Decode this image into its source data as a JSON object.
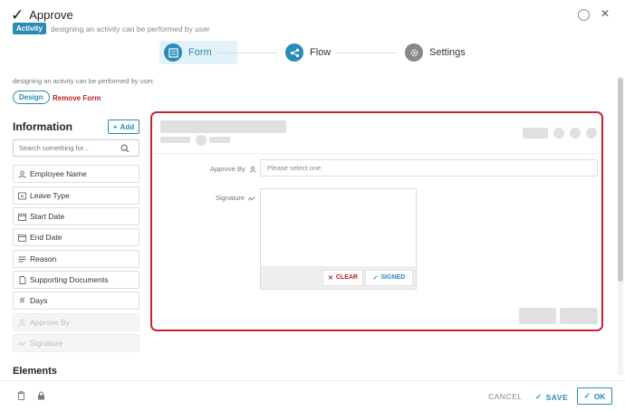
{
  "header": {
    "title": "Approve",
    "badge": "Activity",
    "subtitle": "designing an activity can be performed by user"
  },
  "stepper": {
    "steps": [
      {
        "label": "Form",
        "icon": "form-icon",
        "active": true
      },
      {
        "label": "Flow",
        "icon": "flow-icon",
        "active": false
      },
      {
        "label": "Settings",
        "icon": "gear-icon",
        "active": false
      }
    ]
  },
  "description": "designing an activity can be performed by user.",
  "toolbar": {
    "design_label": "Design",
    "remove_label": "Remove Form"
  },
  "sidebar": {
    "title": "Information",
    "add_label": "Add",
    "search_placeholder": "Search something for...",
    "fields": [
      {
        "label": "Employee Name",
        "icon": "user-icon",
        "disabled": false
      },
      {
        "label": "Leave Type",
        "icon": "dropdown-icon",
        "disabled": false
      },
      {
        "label": "Start Date",
        "icon": "calendar-icon",
        "disabled": false
      },
      {
        "label": "End Date",
        "icon": "calendar-icon",
        "disabled": false
      },
      {
        "label": "Reason",
        "icon": "text-lines-icon",
        "disabled": false
      },
      {
        "label": "Supporting Documents",
        "icon": "file-icon",
        "disabled": false
      },
      {
        "label": "Days",
        "icon": "hash-icon",
        "disabled": false
      },
      {
        "label": "Approve By",
        "icon": "user-icon",
        "disabled": true
      },
      {
        "label": "Signature",
        "icon": "signature-icon",
        "disabled": true
      }
    ],
    "elements_title": "Elements"
  },
  "canvas": {
    "approve_label": "Approve By",
    "approve_placeholder": "Please select one",
    "signature_label": "Signature",
    "clear_label": "CLEAR",
    "signed_label": "SIGNED"
  },
  "footer": {
    "cancel_label": "CANCEL",
    "save_label": "SAVE",
    "ok_label": "OK"
  },
  "colors": {
    "accent": "#2a8bb8",
    "danger": "#c0272d"
  }
}
